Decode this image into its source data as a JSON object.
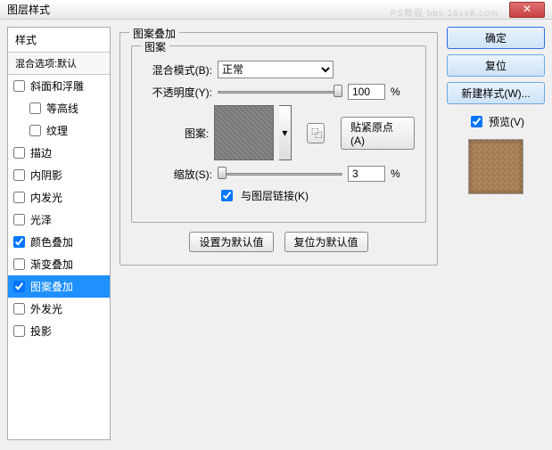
{
  "window": {
    "title": "图层样式",
    "watermark": "PS教程\nbbs.16xx8.com"
  },
  "left": {
    "heading": "样式",
    "subheading": "混合选项:默认",
    "items": [
      {
        "label": "斜面和浮雕",
        "checked": false,
        "indent": false
      },
      {
        "label": "等高线",
        "checked": false,
        "indent": true
      },
      {
        "label": "纹理",
        "checked": false,
        "indent": true
      },
      {
        "label": "描边",
        "checked": false,
        "indent": false
      },
      {
        "label": "内阴影",
        "checked": false,
        "indent": false
      },
      {
        "label": "内发光",
        "checked": false,
        "indent": false
      },
      {
        "label": "光泽",
        "checked": false,
        "indent": false
      },
      {
        "label": "颜色叠加",
        "checked": true,
        "indent": false
      },
      {
        "label": "渐变叠加",
        "checked": false,
        "indent": false
      },
      {
        "label": "图案叠加",
        "checked": true,
        "indent": false,
        "selected": true
      },
      {
        "label": "外发光",
        "checked": false,
        "indent": false
      },
      {
        "label": "投影",
        "checked": false,
        "indent": false
      }
    ]
  },
  "panel": {
    "title": "图案叠加",
    "inner_title": "图案",
    "blend_label": "混合模式(B):",
    "blend_value": "正常",
    "opacity_label": "不透明度(Y):",
    "opacity_value": "100",
    "percent": "%",
    "pattern_label": "图案:",
    "snap_btn": "贴紧原点(A)",
    "scale_label": "缩放(S):",
    "scale_value": "3",
    "link_label": "与图层链接(K)",
    "set_default": "设置为默认值",
    "reset_default": "复位为默认值"
  },
  "right": {
    "ok": "确定",
    "reset": "复位",
    "new_style": "新建样式(W)...",
    "preview": "预览(V)"
  }
}
